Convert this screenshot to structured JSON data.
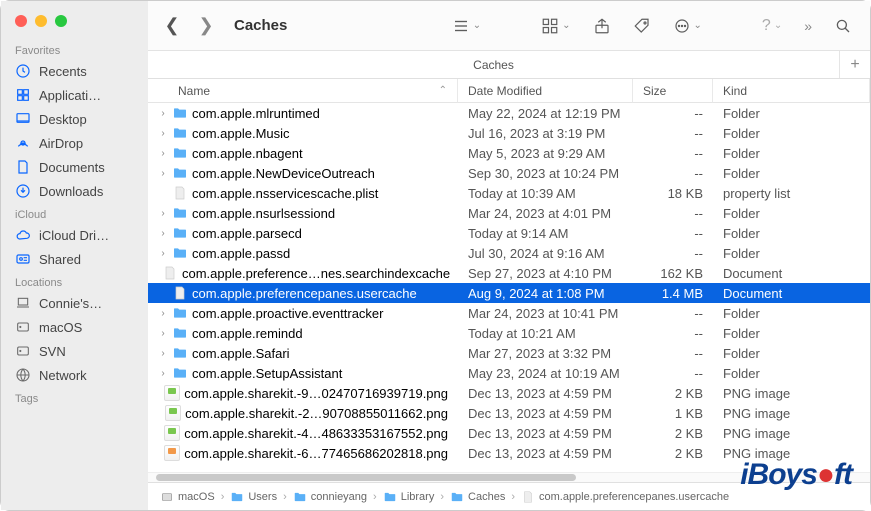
{
  "window_title": "Caches",
  "tab_title": "Caches",
  "sidebar": {
    "sections": [
      {
        "title": "Favorites",
        "items": [
          {
            "label": "Recents",
            "icon": "clock"
          },
          {
            "label": "Applicati…",
            "icon": "apps"
          },
          {
            "label": "Desktop",
            "icon": "desktop"
          },
          {
            "label": "AirDrop",
            "icon": "airdrop"
          },
          {
            "label": "Documents",
            "icon": "doc"
          },
          {
            "label": "Downloads",
            "icon": "download"
          }
        ]
      },
      {
        "title": "iCloud",
        "items": [
          {
            "label": "iCloud Dri…",
            "icon": "cloud"
          },
          {
            "label": "Shared",
            "icon": "shared"
          }
        ]
      },
      {
        "title": "Locations",
        "items": [
          {
            "label": "Connie's…",
            "icon": "laptop",
            "loc": true
          },
          {
            "label": "macOS",
            "icon": "disk",
            "loc": true
          },
          {
            "label": "SVN",
            "icon": "disk",
            "loc": true
          },
          {
            "label": "Network",
            "icon": "globe",
            "loc": true
          }
        ]
      },
      {
        "title": "Tags",
        "items": []
      }
    ]
  },
  "columns": {
    "name": "Name",
    "date": "Date Modified",
    "size": "Size",
    "kind": "Kind"
  },
  "files": [
    {
      "exp": true,
      "icon": "folder",
      "name": "com.apple.mlruntimed",
      "date": "May 22, 2024 at 12:19 PM",
      "size": "--",
      "kind": "Folder"
    },
    {
      "exp": true,
      "icon": "folder",
      "name": "com.apple.Music",
      "date": "Jul 16, 2023 at 3:19 PM",
      "size": "--",
      "kind": "Folder"
    },
    {
      "exp": true,
      "icon": "folder",
      "name": "com.apple.nbagent",
      "date": "May 5, 2023 at 9:29 AM",
      "size": "--",
      "kind": "Folder"
    },
    {
      "exp": true,
      "icon": "folder",
      "name": "com.apple.NewDeviceOutreach",
      "date": "Sep 30, 2023 at 10:24 PM",
      "size": "--",
      "kind": "Folder"
    },
    {
      "exp": false,
      "icon": "doc",
      "name": "com.apple.nsservicescache.plist",
      "date": "Today at 10:39 AM",
      "size": "18 KB",
      "kind": "property list"
    },
    {
      "exp": true,
      "icon": "folder",
      "name": "com.apple.nsurlsessiond",
      "date": "Mar 24, 2023 at 4:01 PM",
      "size": "--",
      "kind": "Folder"
    },
    {
      "exp": true,
      "icon": "folder",
      "name": "com.apple.parsecd",
      "date": "Today at 9:14 AM",
      "size": "--",
      "kind": "Folder"
    },
    {
      "exp": true,
      "icon": "folder",
      "name": "com.apple.passd",
      "date": "Jul 30, 2024 at 9:16 AM",
      "size": "--",
      "kind": "Folder"
    },
    {
      "exp": false,
      "icon": "doc",
      "name": "com.apple.preference…nes.searchindexcache",
      "date": "Sep 27, 2023 at 4:10 PM",
      "size": "162 KB",
      "kind": "Document"
    },
    {
      "exp": false,
      "icon": "doc",
      "name": "com.apple.preferencepanes.usercache",
      "date": "Aug 9, 2024 at 1:08 PM",
      "size": "1.4 MB",
      "kind": "Document",
      "selected": true
    },
    {
      "exp": true,
      "icon": "folder",
      "name": "com.apple.proactive.eventtracker",
      "date": "Mar 24, 2023 at 10:41 PM",
      "size": "--",
      "kind": "Folder"
    },
    {
      "exp": true,
      "icon": "folder",
      "name": "com.apple.remindd",
      "date": "Today at 10:21 AM",
      "size": "--",
      "kind": "Folder"
    },
    {
      "exp": true,
      "icon": "folder",
      "name": "com.apple.Safari",
      "date": "Mar 27, 2023 at 3:32 PM",
      "size": "--",
      "kind": "Folder"
    },
    {
      "exp": true,
      "icon": "folder",
      "name": "com.apple.SetupAssistant",
      "date": "May 23, 2024 at 10:19 AM",
      "size": "--",
      "kind": "Folder"
    },
    {
      "exp": false,
      "icon": "png",
      "name": "com.apple.sharekit.-9…02470716939719.png",
      "date": "Dec 13, 2023 at 4:59 PM",
      "size": "2 KB",
      "kind": "PNG image"
    },
    {
      "exp": false,
      "icon": "png",
      "name": "com.apple.sharekit.-2…90708855011662.png",
      "date": "Dec 13, 2023 at 4:59 PM",
      "size": "1 KB",
      "kind": "PNG image"
    },
    {
      "exp": false,
      "icon": "png",
      "name": "com.apple.sharekit.-4…48633353167552.png",
      "date": "Dec 13, 2023 at 4:59 PM",
      "size": "2 KB",
      "kind": "PNG image"
    },
    {
      "exp": false,
      "icon": "png-o",
      "name": "com.apple.sharekit.-6…77465686202818.png",
      "date": "Dec 13, 2023 at 4:59 PM",
      "size": "2 KB",
      "kind": "PNG image"
    }
  ],
  "pathbar": [
    {
      "label": "macOS",
      "icon": "disk"
    },
    {
      "label": "Users",
      "icon": "folder"
    },
    {
      "label": "connieyang",
      "icon": "folder"
    },
    {
      "label": "Library",
      "icon": "folder"
    },
    {
      "label": "Caches",
      "icon": "folder"
    },
    {
      "label": "com.apple.preferencepanes.usercache",
      "icon": "doc"
    }
  ],
  "watermark": "iBoysoft"
}
